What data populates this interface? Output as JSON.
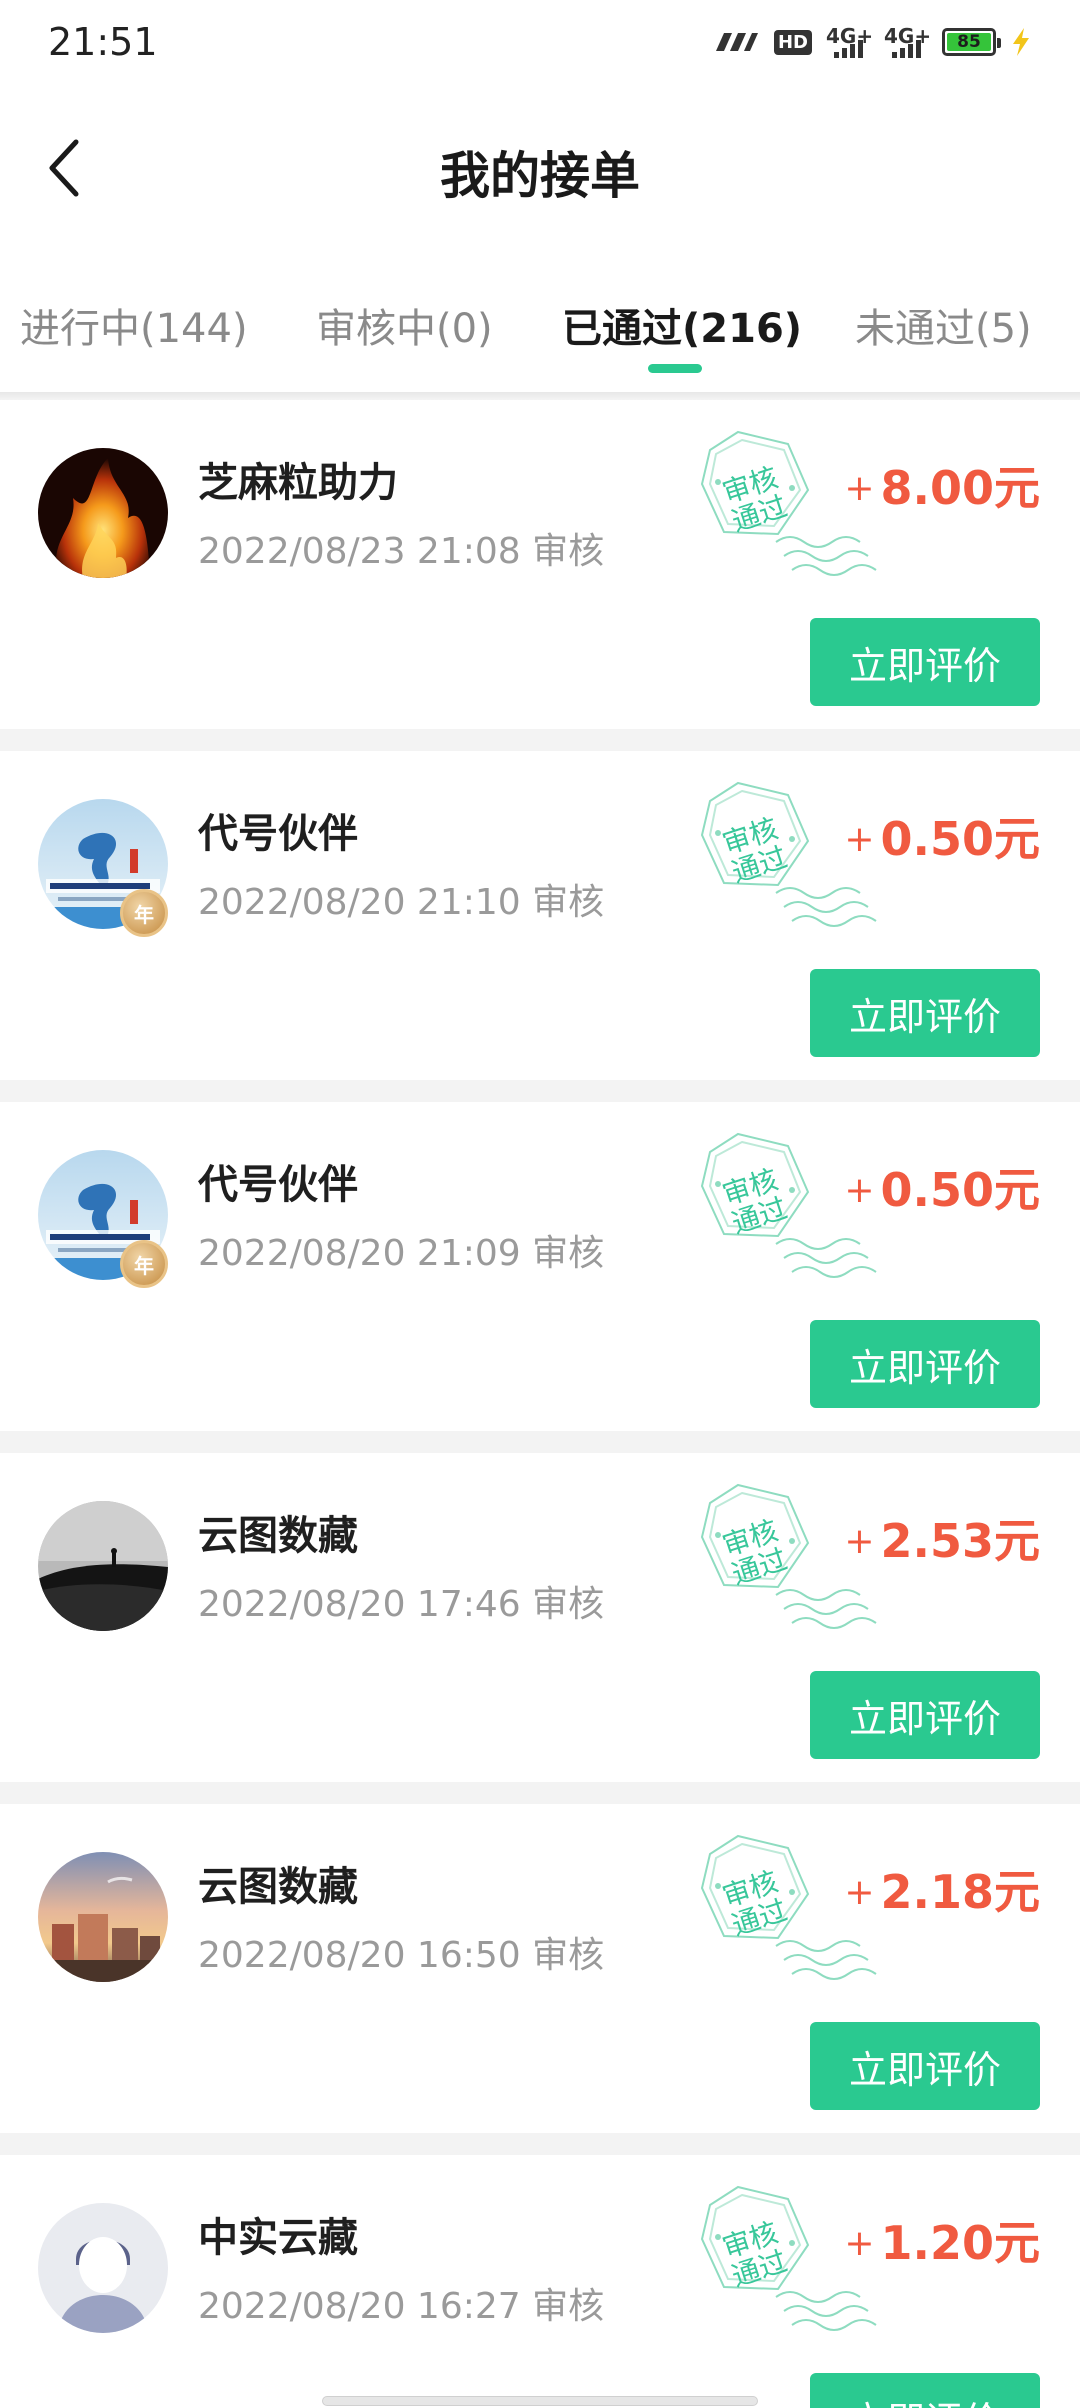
{
  "status_bar": {
    "time": "21:51",
    "hd": "HD",
    "net1": "4G+",
    "net2": "4G+",
    "battery": "85",
    "icons": [
      "network-speed-icon",
      "hd-icon",
      "signal-icon",
      "signal-icon",
      "battery-icon",
      "charging-bolt-icon"
    ]
  },
  "header": {
    "title": "我的接单",
    "back_icon": "chevron-left-icon"
  },
  "tabs": [
    {
      "label": "进行中(144)",
      "active": false
    },
    {
      "label": "审核中(0)",
      "active": false
    },
    {
      "label": "已通过(216)",
      "active": true
    },
    {
      "label": "未通过(5)",
      "active": false
    }
  ],
  "colors": {
    "accent": "#2ac990",
    "reward": "#f05a40",
    "stamp": "#38c79a"
  },
  "orders": [
    {
      "name": "芝麻粒助力",
      "time": "2022/08/23 21:08 审核",
      "stamp": "审核\n通过",
      "plus": "+",
      "amount": "8.00元",
      "button": "立即评价",
      "avatar": "flame-photo",
      "badge": ""
    },
    {
      "name": "代号伙伴",
      "time": "2022/08/20 21:10 审核",
      "stamp": "审核\n通过",
      "plus": "+",
      "amount": "0.50元",
      "button": "立即评价",
      "avatar": "company-logo",
      "badge": "年"
    },
    {
      "name": "代号伙伴",
      "time": "2022/08/20 21:09 审核",
      "stamp": "审核\n通过",
      "plus": "+",
      "amount": "0.50元",
      "button": "立即评价",
      "avatar": "company-logo",
      "badge": "年"
    },
    {
      "name": "云图数藏",
      "time": "2022/08/20 17:46 审核",
      "stamp": "审核\n通过",
      "plus": "+",
      "amount": "2.53元",
      "button": "立即评价",
      "avatar": "desert-photo",
      "badge": ""
    },
    {
      "name": "云图数藏",
      "time": "2022/08/20 16:50 审核",
      "stamp": "审核\n通过",
      "plus": "+",
      "amount": "2.18元",
      "button": "立即评价",
      "avatar": "sunset-photo",
      "badge": ""
    },
    {
      "name": "中实云藏",
      "time": "2022/08/20 16:27 审核",
      "stamp": "审核\n通过",
      "plus": "+",
      "amount": "1.20元",
      "button": "立即评价",
      "avatar": "default-user",
      "badge": ""
    }
  ]
}
